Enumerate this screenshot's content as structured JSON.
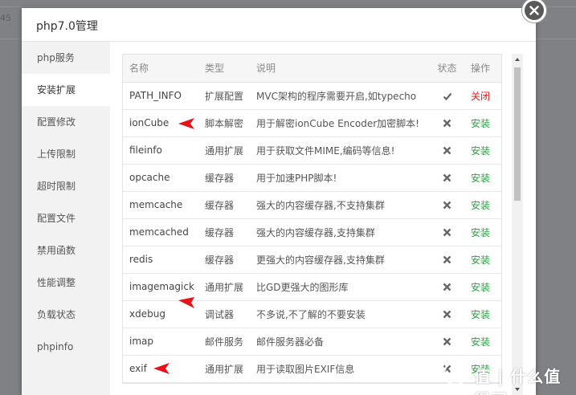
{
  "background": {
    "corner_text": "45"
  },
  "modal": {
    "title": "php7.0管理"
  },
  "sidebar": {
    "items": [
      {
        "label": "php服务"
      },
      {
        "label": "安装扩展"
      },
      {
        "label": "配置修改"
      },
      {
        "label": "上传限制"
      },
      {
        "label": "超时限制"
      },
      {
        "label": "配置文件"
      },
      {
        "label": "禁用函数"
      },
      {
        "label": "性能调整"
      },
      {
        "label": "负载状态"
      },
      {
        "label": "phpinfo"
      }
    ],
    "active_index": 1
  },
  "table": {
    "headers": {
      "name": "名称",
      "type": "类型",
      "desc": "说明",
      "status": "状态",
      "op": "操作"
    },
    "rows": [
      {
        "name": "PATH_INFO",
        "type": "扩展配置",
        "desc": "MVC架构的程序需要开启,如typecho",
        "status": "check-icon",
        "op": "关闭"
      },
      {
        "name": "ionCube",
        "type": "脚本解密",
        "desc": "用于解密ionCube Encoder加密脚本!",
        "status": "cross-icon",
        "op": "安装"
      },
      {
        "name": "fileinfo",
        "type": "通用扩展",
        "desc": "用于获取文件MIME,编码等信息!",
        "status": "cross-icon",
        "op": "安装"
      },
      {
        "name": "opcache",
        "type": "缓存器",
        "desc": "用于加速PHP脚本!",
        "status": "cross-icon",
        "op": "安装"
      },
      {
        "name": "memcache",
        "type": "缓存器",
        "desc": "强大的内容缓存器,不支持集群",
        "status": "cross-icon",
        "op": "安装"
      },
      {
        "name": "memcached",
        "type": "缓存器",
        "desc": "强大的内容缓存器,支持集群",
        "status": "cross-icon",
        "op": "安装"
      },
      {
        "name": "redis",
        "type": "缓存器",
        "desc": "更强大的内容缓存器,支持集群",
        "status": "cross-icon",
        "op": "安装"
      },
      {
        "name": "imagemagick",
        "type": "通用扩展",
        "desc": "比GD更强大的图形库",
        "status": "cross-icon",
        "op": "安装"
      },
      {
        "name": "xdebug",
        "type": "调试器",
        "desc": "不多说,不了解的不要安装",
        "status": "cross-icon",
        "op": "安装"
      },
      {
        "name": "imap",
        "type": "邮件服务",
        "desc": "邮件服务器必备",
        "status": "cross-icon",
        "op": "安装"
      },
      {
        "name": "exif",
        "type": "通用扩展",
        "desc": "用于读取图片EXIF信息",
        "status": "cross-icon",
        "op": "安装"
      }
    ]
  },
  "colors": {
    "install": "#20a53a",
    "close": "#e01a1a",
    "annotation_arrow": "#e8121a"
  },
  "watermark": {
    "text": "值 | 什么值得买"
  }
}
